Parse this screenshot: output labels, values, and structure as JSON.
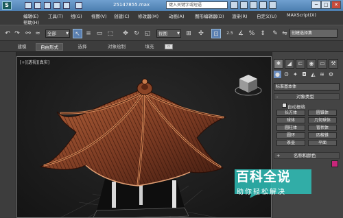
{
  "titlebar": {
    "window_title": "25147855.max",
    "search_placeholder": "键入关键字或短语",
    "min_label": "─",
    "max_label": "□",
    "close_label": "✕"
  },
  "menu": {
    "row1": [
      "编辑(E)",
      "工具(T)",
      "组(G)",
      "视图(V)",
      "创建(C)",
      "修改器(M)",
      "动画(A)",
      "图形编辑器(D)",
      "渲染(R)",
      "自定义(U)",
      "MAXScript(X)"
    ],
    "row2": [
      "帮助(H)"
    ]
  },
  "toolbar": {
    "filter_select": "全部",
    "reference_select": "视图",
    "selection_set_placeholder": "创建选择集",
    "snap_label": "2.5"
  },
  "ribbon": {
    "tabs": [
      "建模",
      "自由形式",
      "选择",
      "对象绘制",
      "填充"
    ],
    "selected_tab": "自由形式",
    "toggle_label": "▭"
  },
  "viewport": {
    "label": "[+][透视][真实]"
  },
  "command_panel": {
    "category_select": "标准基本体",
    "object_type_title": "对象类型",
    "object_type_toggle": "-",
    "autogrid_label": "自动栅格",
    "primitives": [
      "长方体",
      "圆锥体",
      "球体",
      "几何球体",
      "圆柱体",
      "管状体",
      "圆环",
      "四棱锥",
      "茶壶",
      "平面"
    ],
    "name_color_title": "名称和颜色",
    "name_color_toggle": "+"
  },
  "watermark": {
    "title": "百科全说",
    "subtitle": "助你轻松解决"
  },
  "colors": {
    "accent": "#5a7fb0",
    "object_color": "#c8267b",
    "roof": "#7a3a22"
  }
}
